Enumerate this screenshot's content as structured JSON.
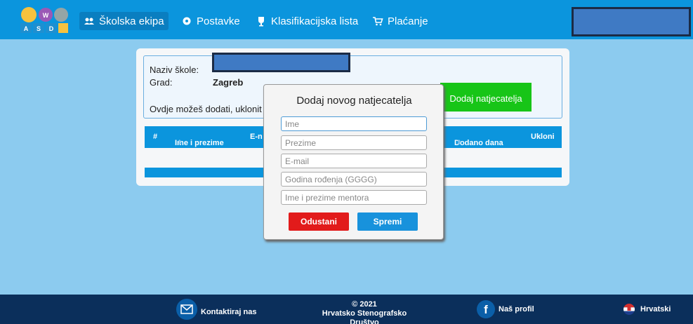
{
  "nav": {
    "team": "Školska ekipa",
    "settings": "Postavke",
    "ranking": "Klasifikacijska lista",
    "payment": "Plaćanje",
    "logo_letters": [
      "W",
      "A",
      "S",
      "D"
    ]
  },
  "school": {
    "name_label": "Naziv škole:",
    "city_label": "Grad:",
    "city_value": "Zagreb",
    "hint": "Ovdje možeš dodati, uklonit",
    "add_button": "Dodaj natjecatelja"
  },
  "table": {
    "headers": [
      "#",
      "Ime i prezime",
      "E-n",
      "Dodano dana",
      "Ukloni"
    ]
  },
  "modal": {
    "title": "Dodaj novog natjecatelja",
    "fields": [
      {
        "placeholder": "Ime"
      },
      {
        "placeholder": "Prezime"
      },
      {
        "placeholder": "E-mail"
      },
      {
        "placeholder": "Godina rođenja (GGGG)"
      },
      {
        "placeholder": "Ime i prezime mentora"
      }
    ],
    "cancel": "Odustani",
    "save": "Spremi"
  },
  "footer": {
    "contact": "Kontaktiraj nas",
    "copyright_year": "© 2021",
    "organization": "Hrvatsko Stenografsko Društvo",
    "profile": "Naš profil",
    "language": "Hrvatski"
  },
  "colors": {
    "accent": "#0b95dd",
    "page_bg": "#8ccbef",
    "success": "#17c517",
    "danger": "#e21b1b",
    "footer_bg": "#0b2f5b"
  },
  "icons": {
    "team": "users-icon",
    "settings": "gear-icon",
    "ranking": "trophy-icon",
    "payment": "cart-icon",
    "contact": "envelope-icon",
    "profile": "facebook-icon",
    "language": "croatia-flag-icon"
  }
}
